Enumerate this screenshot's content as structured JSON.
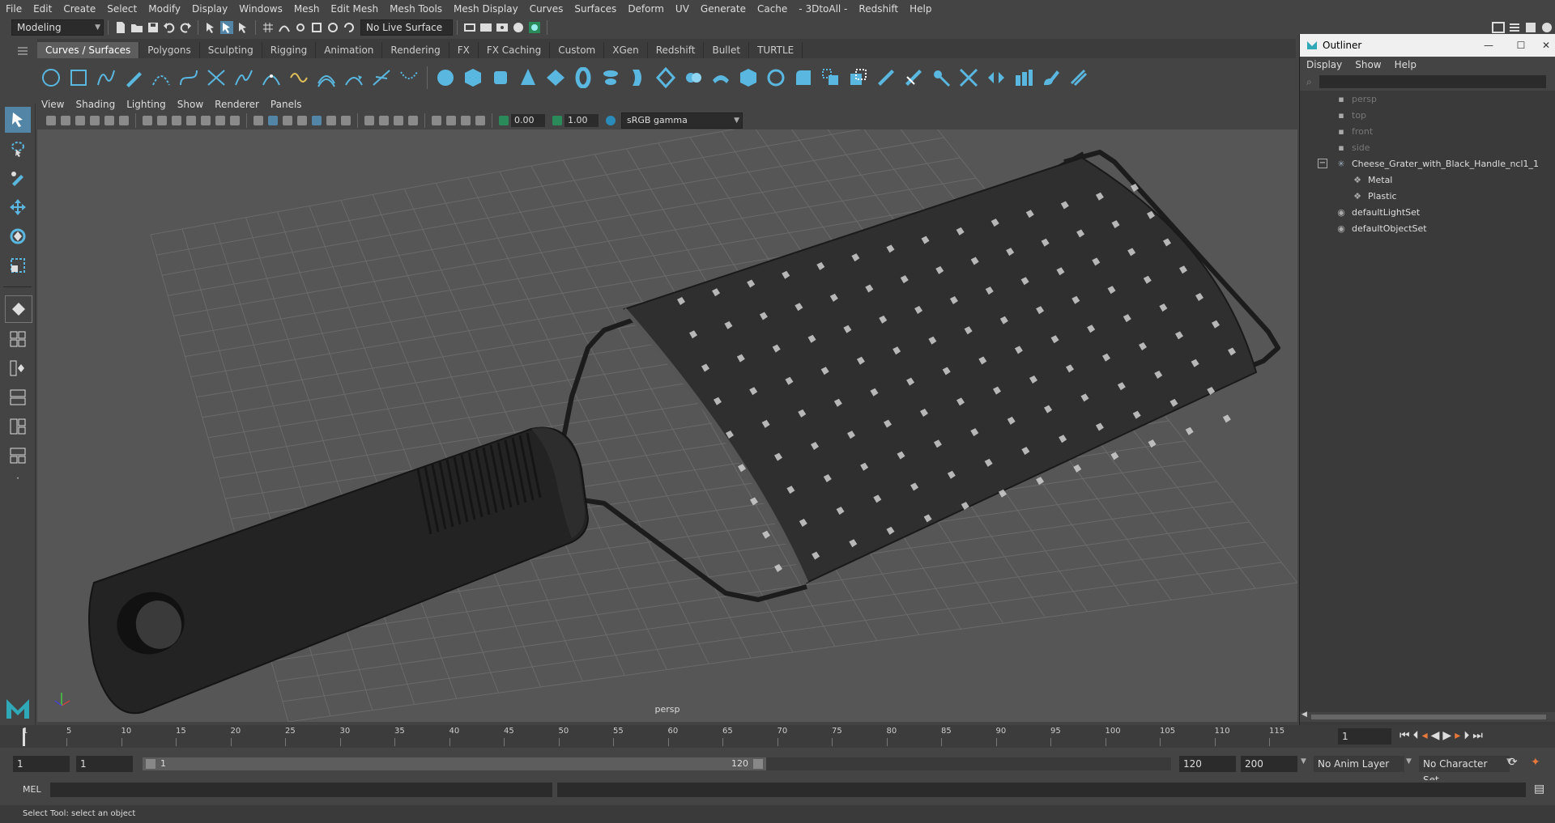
{
  "menubar": {
    "items": [
      "File",
      "Edit",
      "Create",
      "Select",
      "Modify",
      "Display",
      "Windows",
      "Mesh",
      "Edit Mesh",
      "Mesh Tools",
      "Mesh Display",
      "Curves",
      "Surfaces",
      "Deform",
      "UV",
      "Generate",
      "Cache",
      "- 3DtoAll -",
      "Redshift",
      "Help"
    ]
  },
  "toolbar": {
    "mode": "Modeling",
    "live_surface": "No Live Surface"
  },
  "shelf": {
    "tabs": [
      "Curves / Surfaces",
      "Polygons",
      "Sculpting",
      "Rigging",
      "Animation",
      "Rendering",
      "FX",
      "FX Caching",
      "Custom",
      "XGen",
      "Redshift",
      "Bullet",
      "TURTLE"
    ],
    "active_tab": "Curves / Surfaces"
  },
  "viewport": {
    "menu": [
      "View",
      "Shading",
      "Lighting",
      "Show",
      "Renderer",
      "Panels"
    ],
    "exposure": "0.00",
    "gamma": "1.00",
    "color_space": "sRGB gamma",
    "camera_label": "persp"
  },
  "outliner": {
    "title": "Outliner",
    "menu": [
      "Display",
      "Show",
      "Help"
    ],
    "items": [
      {
        "label": "persp",
        "kind": "camera",
        "depth": 1,
        "dim": true
      },
      {
        "label": "top",
        "kind": "camera",
        "depth": 1,
        "dim": true
      },
      {
        "label": "front",
        "kind": "camera",
        "depth": 1,
        "dim": true
      },
      {
        "label": "side",
        "kind": "camera",
        "depth": 1,
        "dim": true
      },
      {
        "label": "Cheese_Grater_with_Black_Handle_ncl1_1",
        "kind": "group",
        "depth": 1,
        "dim": false
      },
      {
        "label": "Metal",
        "kind": "mesh",
        "depth": 2,
        "dim": false
      },
      {
        "label": "Plastic",
        "kind": "mesh",
        "depth": 2,
        "dim": false
      },
      {
        "label": "defaultLightSet",
        "kind": "set",
        "depth": 1,
        "dim": false
      },
      {
        "label": "defaultObjectSet",
        "kind": "set",
        "depth": 1,
        "dim": false
      }
    ]
  },
  "timeline": {
    "ticks": [
      "1",
      "5",
      "10",
      "15",
      "20",
      "25",
      "30",
      "35",
      "40",
      "45",
      "50",
      "55",
      "60",
      "65",
      "70",
      "75",
      "80",
      "85",
      "90",
      "95",
      "100",
      "105",
      "110",
      "115"
    ],
    "current_frame": "1"
  },
  "range": {
    "start": "1",
    "playback_start": "1",
    "slider_start": "1",
    "slider_end": "120",
    "playback_end": "120",
    "end": "200",
    "anim_layer": "No Anim Layer",
    "character_set": "No Character Set"
  },
  "command": {
    "language": "MEL"
  },
  "helpline": {
    "text": "Select Tool: select an object"
  },
  "colors": {
    "accent": "#5285a6",
    "shelf_icon": "#5ab7e0",
    "grid": "#6a6a6a"
  }
}
